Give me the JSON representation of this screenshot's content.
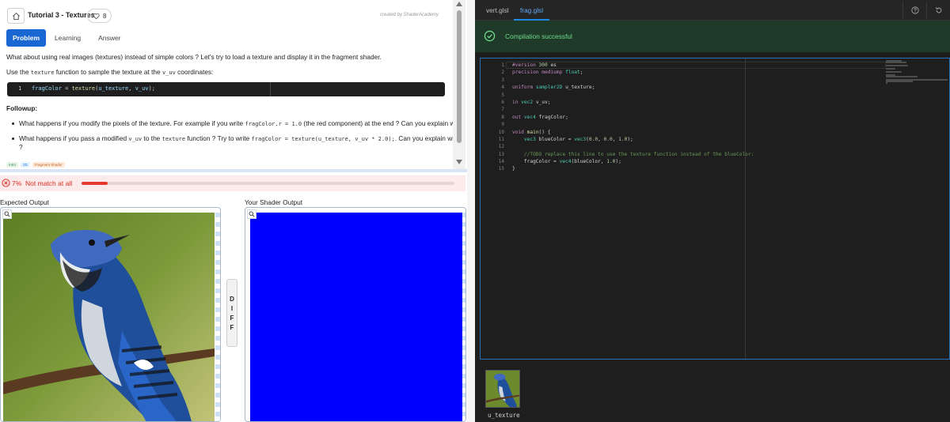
{
  "header": {
    "title": "Tutorial 3 - Textures",
    "likes": "8",
    "created_by": "created by ShaderAcademy"
  },
  "tabs": [
    {
      "label": "Problem",
      "active": true
    },
    {
      "label": "Learning",
      "active": false
    },
    {
      "label": "Answer",
      "active": false
    }
  ],
  "description": {
    "line1": "What about using real images (textures) instead of simple colors ? Let's try to load a texture and display it in the fragment shader.",
    "line2_pre": "Use the ",
    "line2_code1": "texture",
    "line2_mid": " function to sample the texture at the ",
    "line2_code2": "v_uv",
    "line2_post": " coordinates:",
    "code_line_no": "1",
    "code_text": "fragColor = texture(u_texture, v_uv);",
    "followup_label": "Followup:",
    "bullet1_pre": "What happens if you modify the pixels of the texture. For example if you write ",
    "bullet1_code": "fragColor.r = 1.0",
    "bullet1_post": " (the red component) at the end ? Can you explain why ?",
    "bullet2_pre": "What happens if you pass a modified ",
    "bullet2_code1": "v_uv",
    "bullet2_mid": " to the ",
    "bullet2_code2": "texture",
    "bullet2_mid2": " function ? Try to write ",
    "bullet2_code3": "fragColor = texture(u_texture, v_uv * 2.0);",
    "bullet2_post": ". Can you explain why",
    "bullet2_cont": "?"
  },
  "tags": [
    {
      "label": "Intro",
      "bg": "#e6f4ea",
      "color": "#3c8a50"
    },
    {
      "label": "2D",
      "bg": "#e3f2fd",
      "color": "#1a73e8"
    },
    {
      "label": "Fragment Shader",
      "bg": "#fde8d7",
      "color": "#c26a2a"
    }
  ],
  "match": {
    "percent_text": "7%",
    "status": "Not match at all",
    "progress": 0.07,
    "color": "#e53935"
  },
  "outputs": {
    "expected_label": "Expected Output",
    "yours_label": "Your Shader Output",
    "shader_color": "#0000ff",
    "diff_letters": [
      "D",
      "I",
      "F",
      "F"
    ]
  },
  "editor": {
    "tabs": [
      {
        "label": "vert.glsl",
        "active": false
      },
      {
        "label": "frag.glsl",
        "active": true
      }
    ],
    "compile_status": "Compilation successful",
    "line_numbers": [
      "1",
      "2",
      "3",
      "4",
      "5",
      "6",
      "7",
      "8",
      "9",
      "10",
      "11",
      "12",
      "13",
      "14",
      "15"
    ],
    "code": [
      "#version 300 es",
      "precision mediump float;",
      "",
      "uniform sampler2D u_texture;",
      "",
      "in vec2 v_uv;",
      "",
      "out vec4 fragColor;",
      "",
      "void main() {",
      "    vec3 blueColor = vec3(0.0, 0.0, 1.0);",
      "",
      "    //TODO replace this line to use the texture function instead of the blueColor:",
      "    fragColor = vec4(blueColor, 1.0);",
      "}"
    ],
    "texture_name": "u_texture"
  },
  "icons": {
    "home": "home-icon",
    "heart": "heart-icon",
    "help": "help-circle-icon",
    "reset": "reset-icon",
    "check": "check-circle-icon",
    "error": "error-circle-icon",
    "zoom": "zoom-icon"
  }
}
